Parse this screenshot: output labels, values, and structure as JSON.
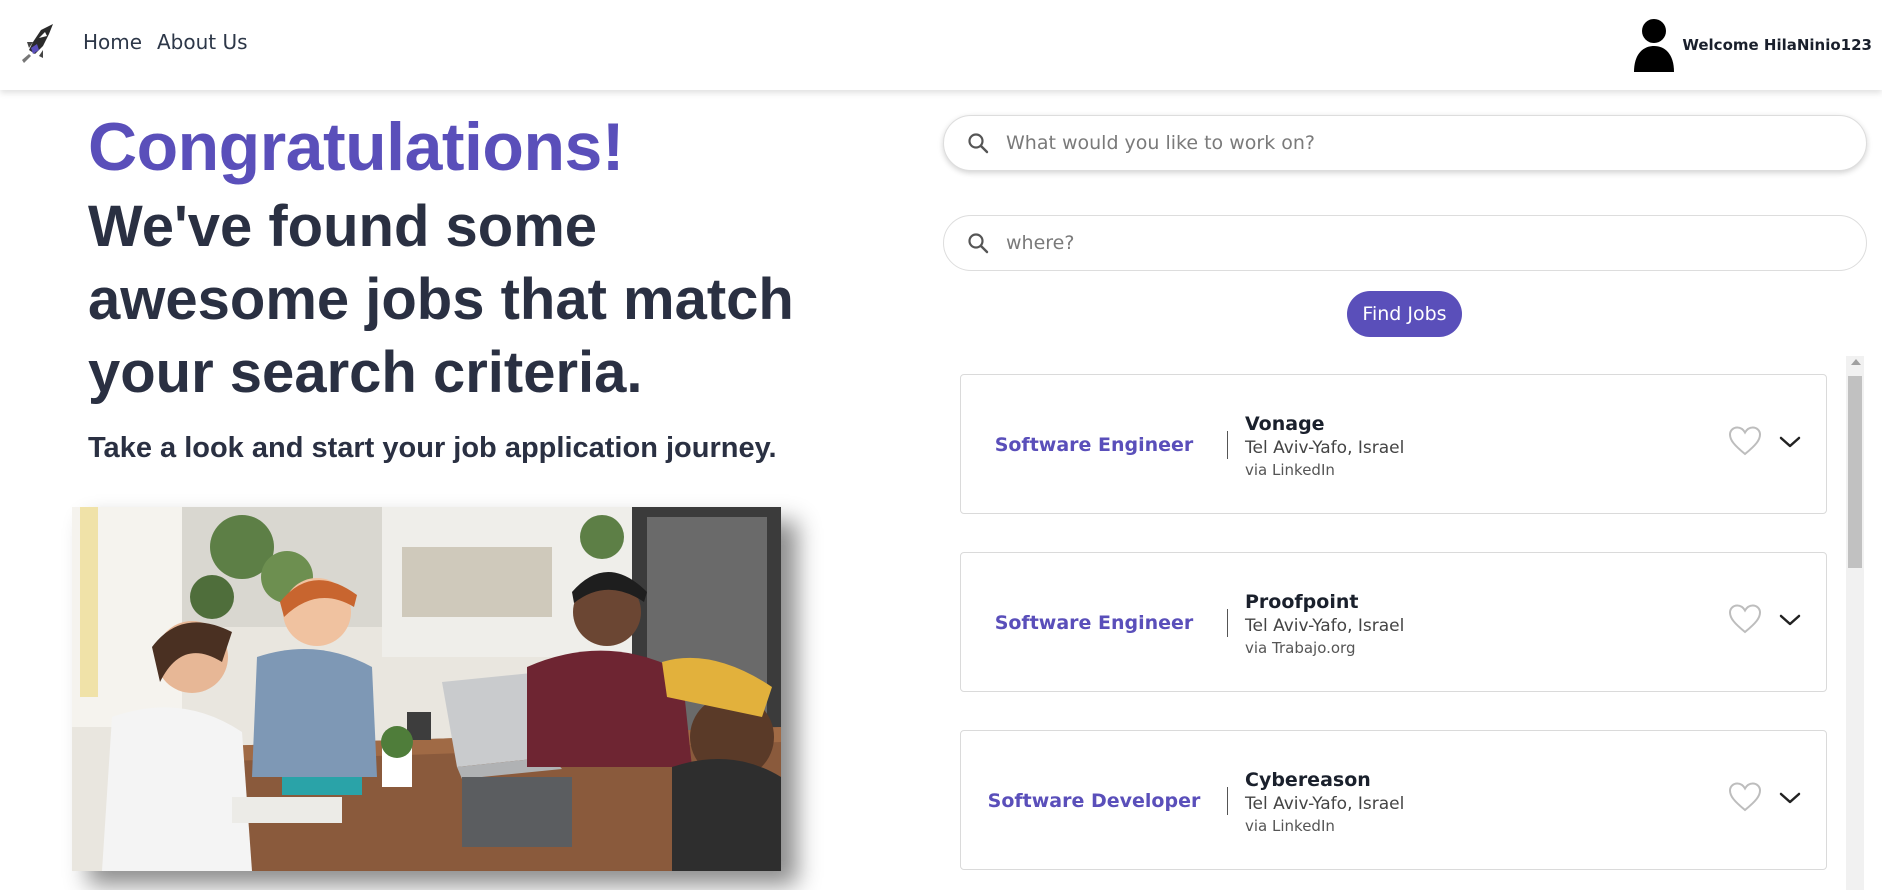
{
  "nav": {
    "home_label": "Home",
    "about_label": "About Us",
    "welcome_text": "Welcome HilaNinio123"
  },
  "hero": {
    "title": "Congratulations!",
    "headline": "We've found some awesome jobs that match your search criteria.",
    "subtitle": "Take a look and start your job application journey."
  },
  "search": {
    "what_placeholder": "What would you like to work on?",
    "where_placeholder": "where?",
    "button_label": "Find Jobs"
  },
  "jobs": [
    {
      "title": "Software Engineer",
      "company": "Vonage",
      "location": "Tel Aviv-Yafo, Israel",
      "source": "via LinkedIn"
    },
    {
      "title": "Software Engineer",
      "company": "Proofpoint",
      "location": "Tel Aviv-Yafo, Israel",
      "source": "via Trabajo.org"
    },
    {
      "title": "Software Developer",
      "company": "Cybereason",
      "location": "Tel Aviv-Yafo, Israel",
      "source": "via LinkedIn"
    }
  ],
  "colors": {
    "accent": "#5a4fba",
    "heading": "#2a3042"
  },
  "icons": {
    "logo": "rocket-logo-icon",
    "user": "user-avatar-icon",
    "search": "search-icon",
    "favorite": "heart-outline-icon",
    "expand": "chevron-down-icon"
  }
}
